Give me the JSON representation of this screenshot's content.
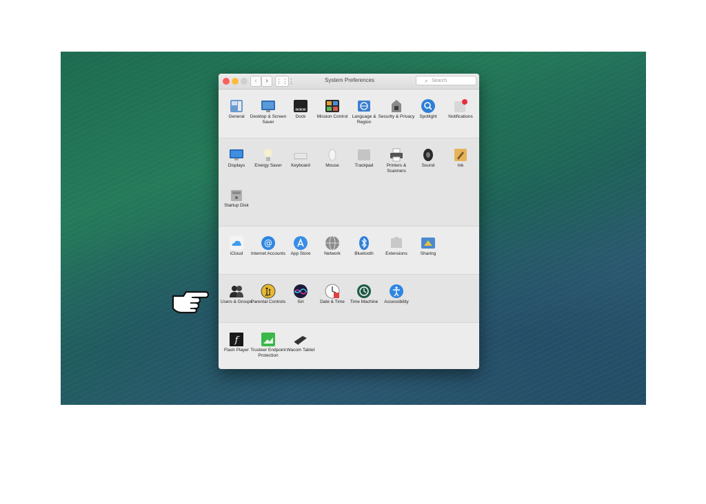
{
  "window": {
    "title": "System Preferences",
    "search_placeholder": "Search",
    "nav_back": "‹",
    "nav_forward": "›",
    "grid_glyph": "⋮⋮⋮"
  },
  "sections": [
    {
      "items": [
        {
          "label": "General",
          "icon": "general-icon"
        },
        {
          "label": "Desktop & Screen Saver",
          "icon": "desktop-icon"
        },
        {
          "label": "Dock",
          "icon": "dock-icon"
        },
        {
          "label": "Mission Control",
          "icon": "mission-control-icon"
        },
        {
          "label": "Language & Region",
          "icon": "language-icon"
        },
        {
          "label": "Security & Privacy",
          "icon": "security-icon"
        },
        {
          "label": "Spotlight",
          "icon": "spotlight-icon"
        },
        {
          "label": "Notifications",
          "icon": "notifications-icon"
        }
      ]
    },
    {
      "items": [
        {
          "label": "Displays",
          "icon": "displays-icon"
        },
        {
          "label": "Energy Saver",
          "icon": "energy-saver-icon"
        },
        {
          "label": "Keyboard",
          "icon": "keyboard-icon"
        },
        {
          "label": "Mouse",
          "icon": "mouse-icon"
        },
        {
          "label": "Trackpad",
          "icon": "trackpad-icon"
        },
        {
          "label": "Printers & Scanners",
          "icon": "printer-icon"
        },
        {
          "label": "Sound",
          "icon": "sound-icon"
        },
        {
          "label": "Ink",
          "icon": "ink-icon"
        },
        {
          "label": "Startup Disk",
          "icon": "startup-disk-icon"
        }
      ]
    },
    {
      "items": [
        {
          "label": "iCloud",
          "icon": "icloud-icon"
        },
        {
          "label": "Internet Accounts",
          "icon": "internet-accounts-icon"
        },
        {
          "label": "App Store",
          "icon": "app-store-icon"
        },
        {
          "label": "Network",
          "icon": "network-icon"
        },
        {
          "label": "Bluetooth",
          "icon": "bluetooth-icon"
        },
        {
          "label": "Extensions",
          "icon": "extensions-icon"
        },
        {
          "label": "Sharing",
          "icon": "sharing-icon"
        }
      ]
    },
    {
      "items": [
        {
          "label": "Users & Groups",
          "icon": "users-icon"
        },
        {
          "label": "Parental Controls",
          "icon": "parental-controls-icon"
        },
        {
          "label": "Siri",
          "icon": "siri-icon"
        },
        {
          "label": "Date & Time",
          "icon": "date-time-icon"
        },
        {
          "label": "Time Machine",
          "icon": "time-machine-icon"
        },
        {
          "label": "Accessibility",
          "icon": "accessibility-icon"
        }
      ]
    },
    {
      "items": [
        {
          "label": "Flash Player",
          "icon": "flash-player-icon"
        },
        {
          "label": "Trusteer Endpoint Protection",
          "icon": "trusteer-icon"
        },
        {
          "label": "Wacom Tablet",
          "icon": "wacom-icon"
        }
      ]
    }
  ],
  "highlighted_item": "Parental Controls",
  "colors": {
    "highlight_border": "#e0405a",
    "close": "#fc605c",
    "minimize": "#fdbc40"
  }
}
